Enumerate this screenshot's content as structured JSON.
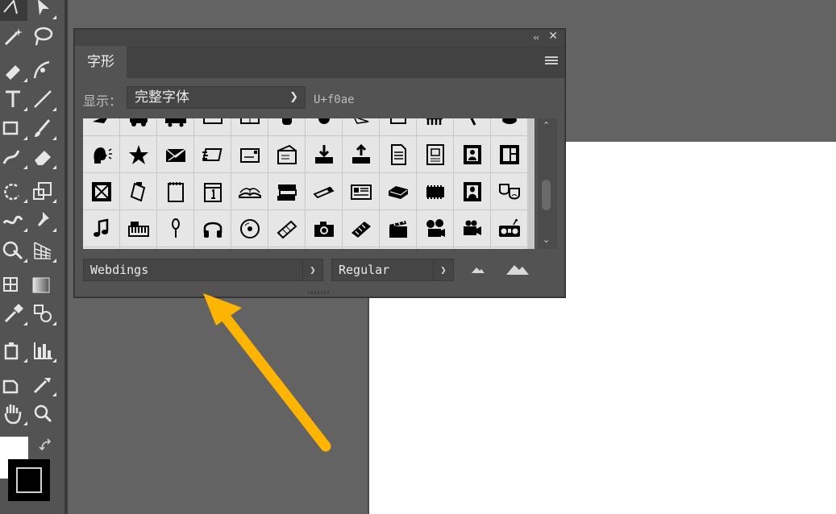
{
  "panel": {
    "tab_label": "字形",
    "show_label": "显示：",
    "show_value": "完整字体",
    "unicode": "U+f0ae",
    "font_family": "Webdings",
    "font_style": "Regular",
    "collapse_glyph": "‹‹",
    "close_glyph": "✕"
  },
  "glyph_rows": [
    [
      "bird",
      "car",
      "truck",
      "bus",
      "tv",
      "barrel",
      "drop",
      "bird2",
      "hut",
      "fence",
      "stick",
      "hat"
    ],
    [
      "speaking-head",
      "star",
      "envelope-x",
      "fast-mail",
      "card",
      "mailbox",
      "inbox-down",
      "inbox-up",
      "document",
      "framed-doc",
      "framed-person",
      "window-frame"
    ],
    [
      "x-frame",
      "clipboard",
      "notepad",
      "calendar",
      "open-book",
      "book-stack",
      "scroll",
      "newspaper",
      "tray",
      "film-roll",
      "mona-lisa",
      "theater-masks"
    ],
    [
      "music-note",
      "keyboard",
      "microphone",
      "headphones",
      "cd",
      "film-strip",
      "camera",
      "film-reel",
      "clapperboard",
      "projector",
      "video-camera",
      "boombox"
    ]
  ],
  "colors": {
    "background": "#636363",
    "toolbar": "#535353",
    "panel": "#535353",
    "artboard": "#ffffff",
    "arrow": "#ffb400"
  },
  "tools": [
    "select",
    "direct-select",
    "magic-wand",
    "lasso",
    "pen",
    "curvature",
    "type",
    "line",
    "rectangle",
    "paintbrush",
    "shaper",
    "eraser",
    "rotate",
    "scale",
    "warp",
    "free-transform",
    "shape-builder",
    "perspective-grid",
    "mesh",
    "gradient",
    "eyedropper",
    "blend",
    "symbol-sprayer",
    "column-graph",
    "artboard",
    "slice",
    "hand",
    "zoom"
  ]
}
